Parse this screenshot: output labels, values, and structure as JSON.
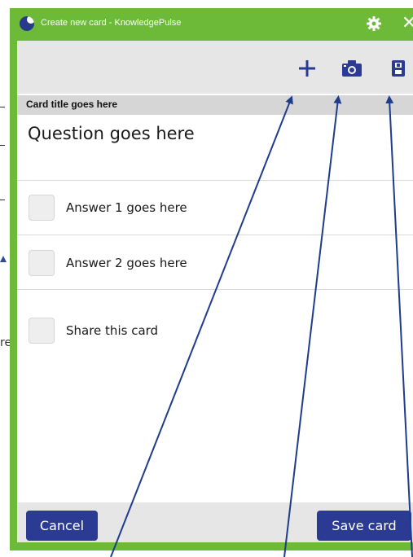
{
  "background": {
    "partial_text": "re"
  },
  "window": {
    "title": "Create new card - KnowledgePulse",
    "titlebar_icons": [
      "gear-icon",
      "close-icon"
    ],
    "close_glyph": "✕",
    "accent_color": "#6cba38"
  },
  "toolbar": {
    "buttons": [
      {
        "name": "add",
        "icon": "plus-icon"
      },
      {
        "name": "camera",
        "icon": "camera-icon"
      },
      {
        "name": "save",
        "icon": "floppy-disk-icon"
      }
    ],
    "icon_color": "#2b3a93"
  },
  "card": {
    "title": "Card title goes here",
    "question": "Question goes here",
    "answers": [
      {
        "label": "Answer 1 goes here",
        "checked": false
      },
      {
        "label": "Answer 2 goes here",
        "checked": false
      }
    ],
    "share": {
      "label": "Share this card",
      "checked": false
    }
  },
  "footer": {
    "cancel_label": "Cancel",
    "save_label": "Save card",
    "button_color": "#2b3a93"
  },
  "annotation": {
    "arrow_color": "#1f3c8c"
  }
}
